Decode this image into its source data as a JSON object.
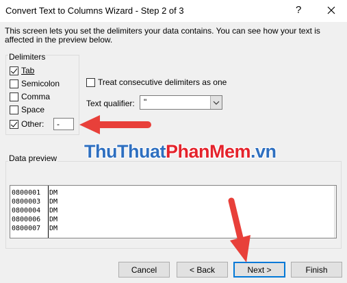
{
  "window": {
    "title": "Convert Text to Columns Wizard - Step 2 of 3",
    "help_glyph": "?",
    "close_icon": "close-icon"
  },
  "description": "This screen lets you set the delimiters your data contains.  You can see how your text is affected in the preview below.",
  "delimiters": {
    "group_label": "Delimiters",
    "items": [
      {
        "label": "Tab",
        "checked": true
      },
      {
        "label": "Semicolon",
        "checked": false
      },
      {
        "label": "Comma",
        "checked": false
      },
      {
        "label": "Space",
        "checked": false
      },
      {
        "label": "Other:",
        "checked": true
      }
    ],
    "other_value": "-"
  },
  "options": {
    "treat_consecutive_label": "Treat consecutive delimiters as one",
    "treat_consecutive_checked": false,
    "text_qualifier_label": "Text qualifier:",
    "text_qualifier_value": "\""
  },
  "preview": {
    "label": "Data preview",
    "rows": [
      [
        "0800001",
        "DM"
      ],
      [
        "0800003",
        "DM"
      ],
      [
        "0800004",
        "DM"
      ],
      [
        "0800006",
        "DM"
      ],
      [
        "0800007",
        "DM"
      ]
    ]
  },
  "buttons": {
    "cancel": "Cancel",
    "back": "< Back",
    "next": "Next >",
    "finish": "Finish"
  },
  "watermark": {
    "part1": "ThuThuat",
    "part2": "PhanMem",
    "part3": ".vn"
  },
  "colors": {
    "arrow": "#e8403a",
    "focus_border": "#0078d7"
  }
}
